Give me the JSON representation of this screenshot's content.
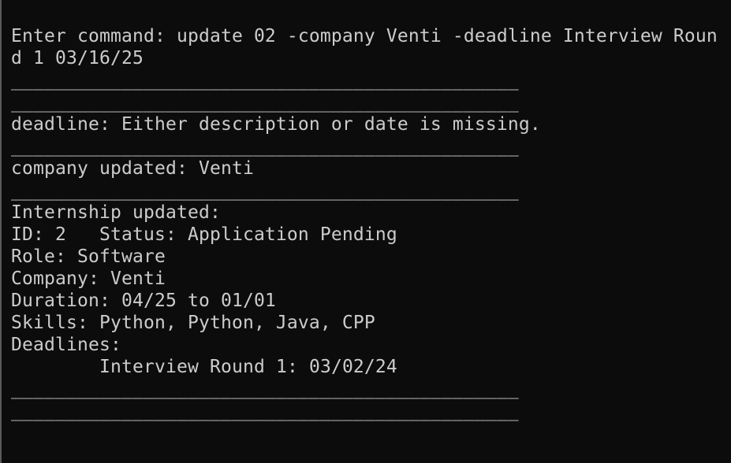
{
  "terminal": {
    "command_line_1": "Enter command: update 02 -company Venti -deadline Interview Roun",
    "command_line_2": "d 1 03/16/25",
    "separator": "______________________________________________",
    "deadline_error": "deadline: Either description or date is missing.",
    "company_updated": "company updated: Venti",
    "internship_header": "Internship updated:",
    "id_status": "ID: 2   Status: Application Pending",
    "role": "Role: Software",
    "company": "Company: Venti",
    "duration": "Duration: 04/25 to 01/01",
    "skills": "Skills: Python, Python, Java, CPP",
    "deadlines_label": "Deadlines:",
    "deadline_item": "Interview Round 1: 03/02/24"
  },
  "colors": {
    "background": "#0c0c0c",
    "text": "#cccccc",
    "left_border": "#5a5a5a"
  }
}
